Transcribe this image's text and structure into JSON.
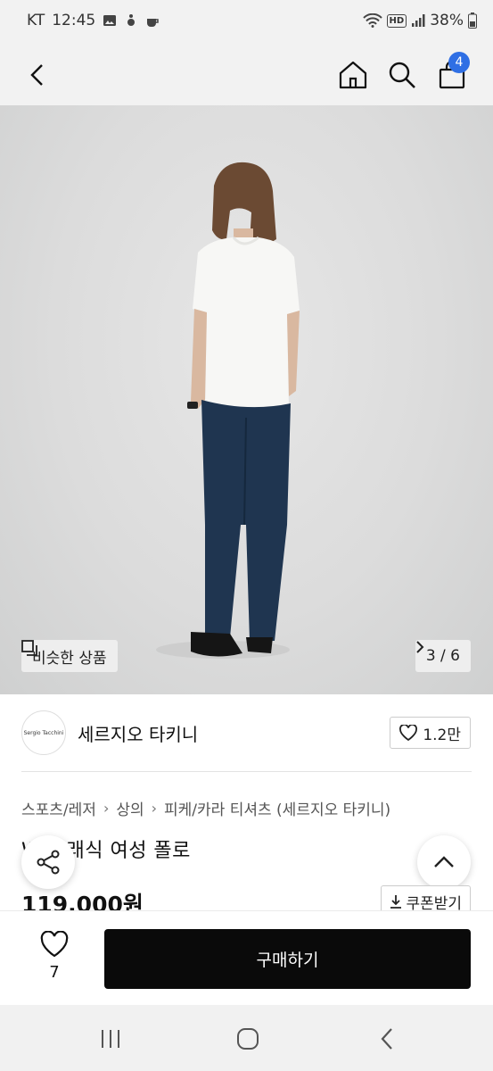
{
  "status_bar": {
    "carrier": "KT",
    "time": "12:45",
    "hd_label": "HD",
    "battery": "38%"
  },
  "nav": {
    "back_icon": "chevron-left-icon",
    "home_icon": "home-icon",
    "search_icon": "search-icon",
    "bag_icon": "shopping-bag-icon",
    "bag_count": "4"
  },
  "image": {
    "similar_label": "비슷한 상품",
    "page_indicator": "3 / 6"
  },
  "brand": {
    "logo_text": "Sergio Tacchini",
    "name": "세르지오 타키니",
    "like_count": "1.2만"
  },
  "breadcrumb": [
    "스포츠/레저",
    "상의",
    "피케/카라 티셔츠 (세르지오 타키니)"
  ],
  "product": {
    "title": "W 클래식 여성 폴로",
    "price": "119,000원",
    "coupon_label": "쿠폰받기"
  },
  "buybar": {
    "wish_count": "7",
    "buy_label": "구매하기"
  },
  "colors": {
    "badge": "#2f6fe4",
    "buy_button": "#0a0a0a"
  }
}
